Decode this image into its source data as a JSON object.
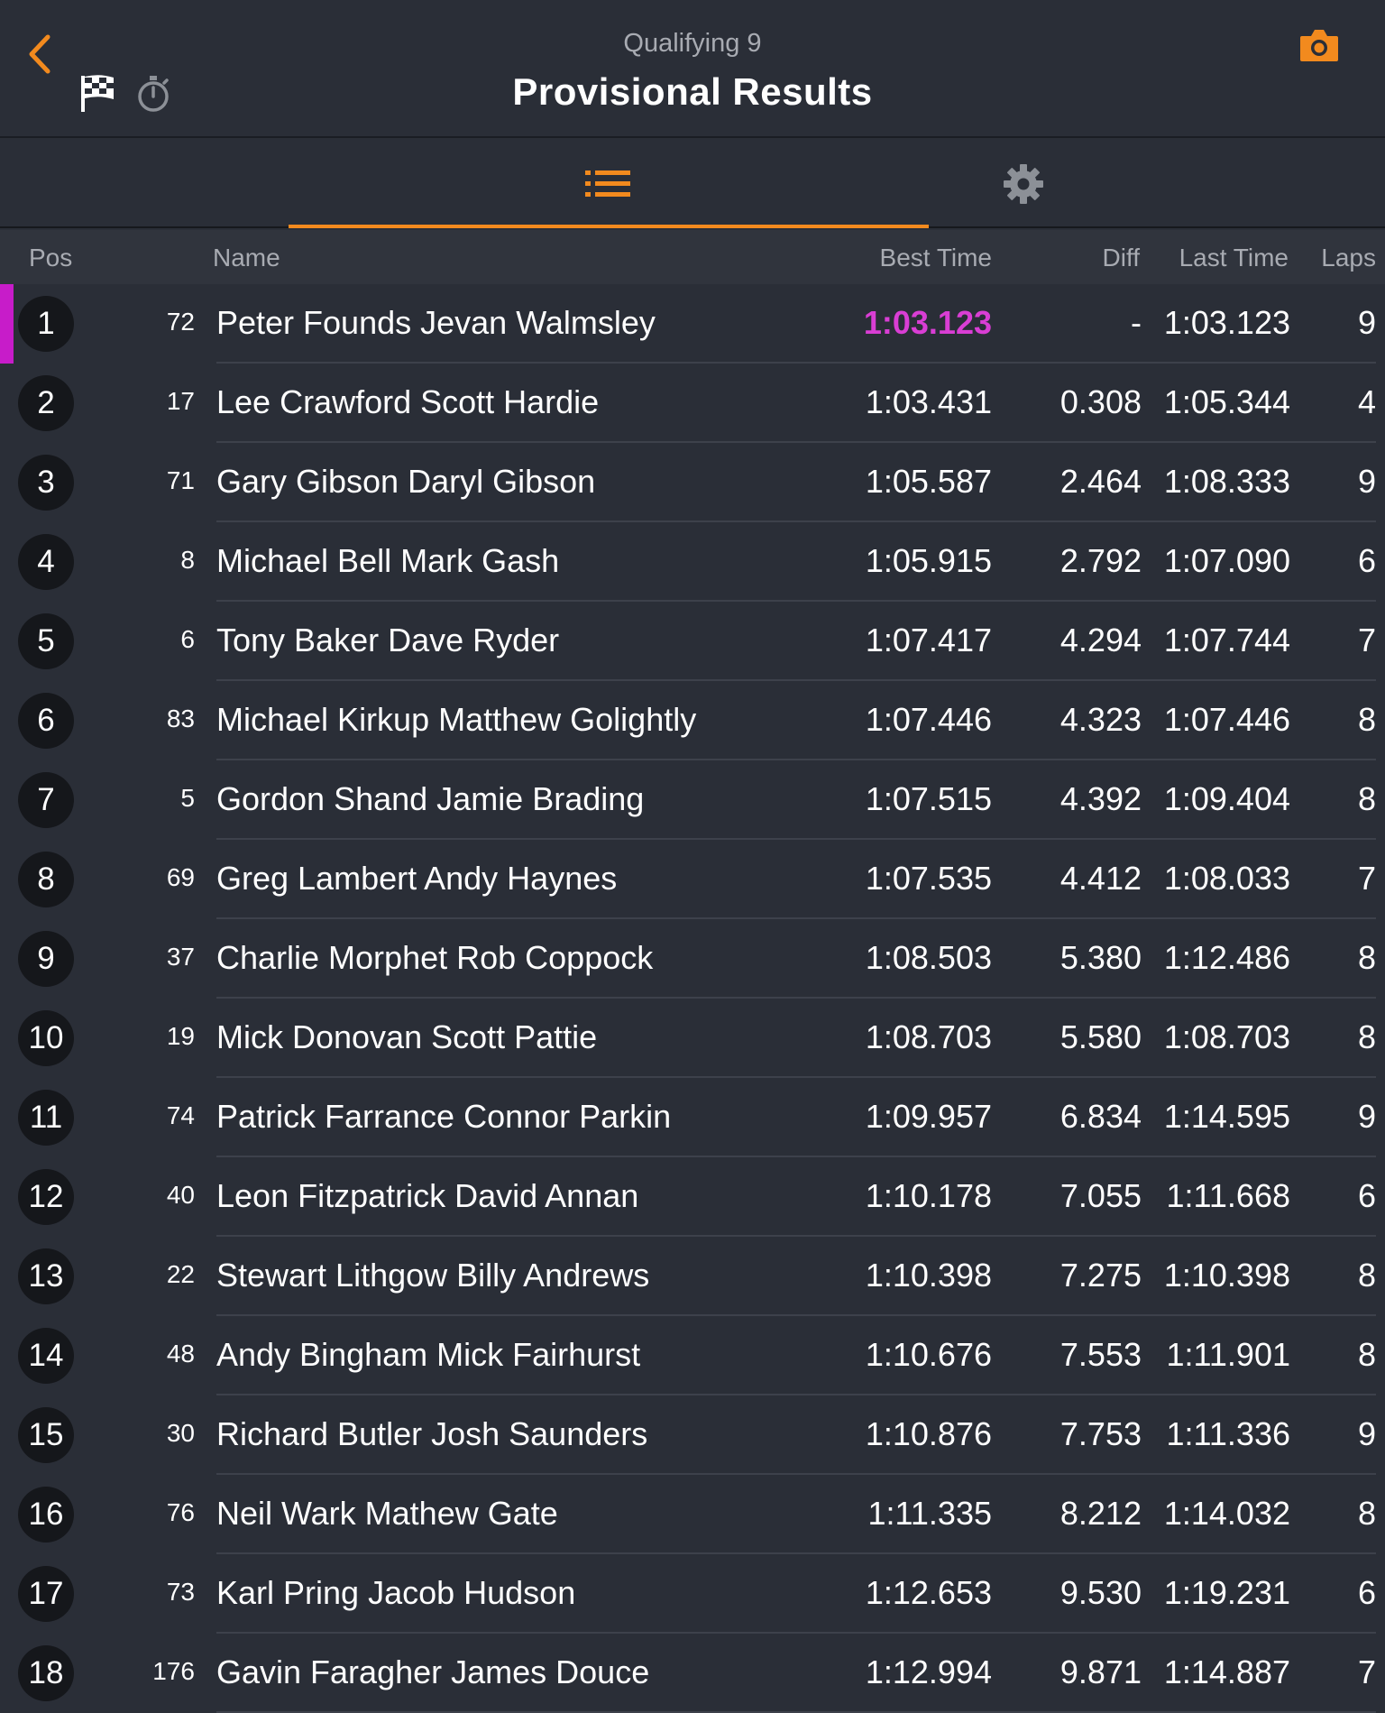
{
  "header": {
    "subtitle": "Qualifying 9",
    "title": "Provisional Results"
  },
  "icons": {
    "back": "chevron-left-icon",
    "flag": "checkered-flag-icon",
    "stopwatch": "stopwatch-icon",
    "camera": "camera-icon",
    "list": "list-icon",
    "settings": "gear-icon"
  },
  "colors": {
    "accent": "#f28a1e",
    "fastest": "#d93ed4",
    "background": "#2a2e37"
  },
  "columns": {
    "pos": "Pos",
    "name": "Name",
    "best": "Best Time",
    "diff": "Diff",
    "last": "Last Time",
    "laps": "Laps"
  },
  "results": [
    {
      "pos": "1",
      "num": "72",
      "name": "Peter Founds Jevan Walmsley",
      "best": "1:03.123",
      "diff": "-",
      "last": "1:03.123",
      "laps": "9",
      "fastest": true
    },
    {
      "pos": "2",
      "num": "17",
      "name": "Lee Crawford Scott Hardie",
      "best": "1:03.431",
      "diff": "0.308",
      "last": "1:05.344",
      "laps": "4"
    },
    {
      "pos": "3",
      "num": "71",
      "name": "Gary Gibson Daryl Gibson",
      "best": "1:05.587",
      "diff": "2.464",
      "last": "1:08.333",
      "laps": "9"
    },
    {
      "pos": "4",
      "num": "8",
      "name": "Michael Bell Mark Gash",
      "best": "1:05.915",
      "diff": "2.792",
      "last": "1:07.090",
      "laps": "6"
    },
    {
      "pos": "5",
      "num": "6",
      "name": "Tony Baker Dave Ryder",
      "best": "1:07.417",
      "diff": "4.294",
      "last": "1:07.744",
      "laps": "7"
    },
    {
      "pos": "6",
      "num": "83",
      "name": "Michael Kirkup Matthew Golightly",
      "best": "1:07.446",
      "diff": "4.323",
      "last": "1:07.446",
      "laps": "8"
    },
    {
      "pos": "7",
      "num": "5",
      "name": "Gordon Shand Jamie Brading",
      "best": "1:07.515",
      "diff": "4.392",
      "last": "1:09.404",
      "laps": "8"
    },
    {
      "pos": "8",
      "num": "69",
      "name": "Greg Lambert Andy Haynes",
      "best": "1:07.535",
      "diff": "4.412",
      "last": "1:08.033",
      "laps": "7"
    },
    {
      "pos": "9",
      "num": "37",
      "name": "Charlie Morphet Rob Coppock",
      "best": "1:08.503",
      "diff": "5.380",
      "last": "1:12.486",
      "laps": "8"
    },
    {
      "pos": "10",
      "num": "19",
      "name": "Mick Donovan Scott Pattie",
      "best": "1:08.703",
      "diff": "5.580",
      "last": "1:08.703",
      "laps": "8"
    },
    {
      "pos": "11",
      "num": "74",
      "name": "Patrick Farrance Connor Parkin",
      "best": "1:09.957",
      "diff": "6.834",
      "last": "1:14.595",
      "laps": "9"
    },
    {
      "pos": "12",
      "num": "40",
      "name": "Leon Fitzpatrick David Annan",
      "best": "1:10.178",
      "diff": "7.055",
      "last": "1:11.668",
      "laps": "6"
    },
    {
      "pos": "13",
      "num": "22",
      "name": "Stewart Lithgow Billy Andrews",
      "best": "1:10.398",
      "diff": "7.275",
      "last": "1:10.398",
      "laps": "8"
    },
    {
      "pos": "14",
      "num": "48",
      "name": "Andy Bingham Mick Fairhurst",
      "best": "1:10.676",
      "diff": "7.553",
      "last": "1:11.901",
      "laps": "8"
    },
    {
      "pos": "15",
      "num": "30",
      "name": "Richard Butler Josh Saunders",
      "best": "1:10.876",
      "diff": "7.753",
      "last": "1:11.336",
      "laps": "9"
    },
    {
      "pos": "16",
      "num": "76",
      "name": "Neil Wark Mathew Gate",
      "best": "1:11.335",
      "diff": "8.212",
      "last": "1:14.032",
      "laps": "8"
    },
    {
      "pos": "17",
      "num": "73",
      "name": "Karl Pring Jacob Hudson",
      "best": "1:12.653",
      "diff": "9.530",
      "last": "1:19.231",
      "laps": "6"
    },
    {
      "pos": "18",
      "num": "176",
      "name": "Gavin Faragher James Douce",
      "best": "1:12.994",
      "diff": "9.871",
      "last": "1:14.887",
      "laps": "7"
    }
  ]
}
